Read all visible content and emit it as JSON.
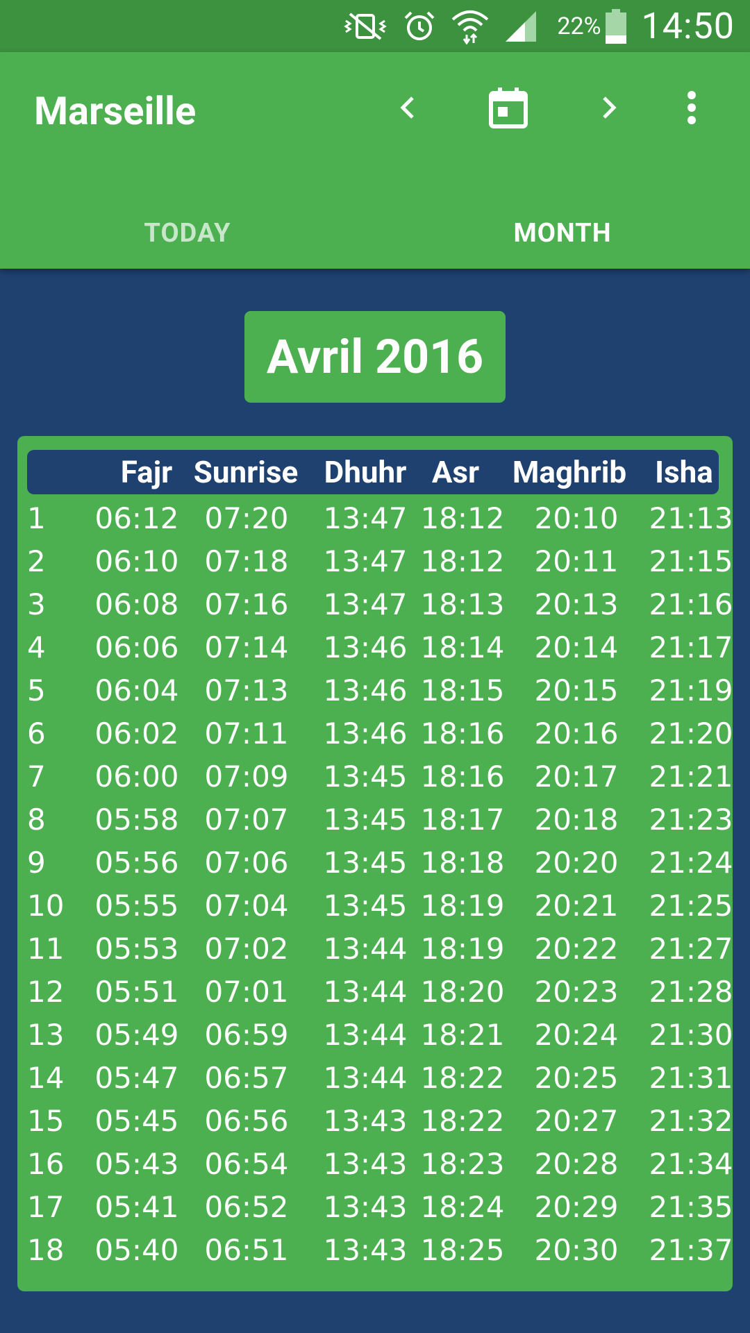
{
  "status_bar": {
    "icons": [
      "vibrate-mute-icon",
      "alarm-icon",
      "wifi-icon",
      "signal-icon",
      "battery-icon"
    ],
    "battery": "22%",
    "time": "14:50"
  },
  "app_bar": {
    "title": "Marseille",
    "actions": [
      "chevron-left-icon",
      "calendar-icon",
      "chevron-right-icon",
      "more-vert-icon"
    ],
    "tabs": [
      {
        "label": "TODAY",
        "selected": false
      },
      {
        "label": "MONTH",
        "selected": true
      }
    ]
  },
  "month_label": "Avril 2016",
  "table": {
    "headers": [
      "Fajr",
      "Sunrise",
      "Dhuhr",
      "Asr",
      "Maghrib",
      "Isha"
    ],
    "rows": [
      [
        "1",
        "06:12",
        "07:20",
        "13:47",
        "18:12",
        "20:10",
        "21:13"
      ],
      [
        "2",
        "06:10",
        "07:18",
        "13:47",
        "18:12",
        "20:11",
        "21:15"
      ],
      [
        "3",
        "06:08",
        "07:16",
        "13:47",
        "18:13",
        "20:13",
        "21:16"
      ],
      [
        "4",
        "06:06",
        "07:14",
        "13:46",
        "18:14",
        "20:14",
        "21:17"
      ],
      [
        "5",
        "06:04",
        "07:13",
        "13:46",
        "18:15",
        "20:15",
        "21:19"
      ],
      [
        "6",
        "06:02",
        "07:11",
        "13:46",
        "18:16",
        "20:16",
        "21:20"
      ],
      [
        "7",
        "06:00",
        "07:09",
        "13:45",
        "18:16",
        "20:17",
        "21:21"
      ],
      [
        "8",
        "05:58",
        "07:07",
        "13:45",
        "18:17",
        "20:18",
        "21:23"
      ],
      [
        "9",
        "05:56",
        "07:06",
        "13:45",
        "18:18",
        "20:20",
        "21:24"
      ],
      [
        "10",
        "05:55",
        "07:04",
        "13:45",
        "18:19",
        "20:21",
        "21:25"
      ],
      [
        "11",
        "05:53",
        "07:02",
        "13:44",
        "18:19",
        "20:22",
        "21:27"
      ],
      [
        "12",
        "05:51",
        "07:01",
        "13:44",
        "18:20",
        "20:23",
        "21:28"
      ],
      [
        "13",
        "05:49",
        "06:59",
        "13:44",
        "18:21",
        "20:24",
        "21:30"
      ],
      [
        "14",
        "05:47",
        "06:57",
        "13:44",
        "18:22",
        "20:25",
        "21:31"
      ],
      [
        "15",
        "05:45",
        "06:56",
        "13:43",
        "18:22",
        "20:27",
        "21:32"
      ],
      [
        "16",
        "05:43",
        "06:54",
        "13:43",
        "18:23",
        "20:28",
        "21:34"
      ],
      [
        "17",
        "05:41",
        "06:52",
        "13:43",
        "18:24",
        "20:29",
        "21:35"
      ],
      [
        "18",
        "05:40",
        "06:51",
        "13:43",
        "18:25",
        "20:30",
        "21:37"
      ]
    ]
  },
  "colors": {
    "primary": "#4caf50",
    "primary_dark": "#3c923f",
    "background": "#1f4170",
    "tab_inactive": "#c8e6c9"
  }
}
